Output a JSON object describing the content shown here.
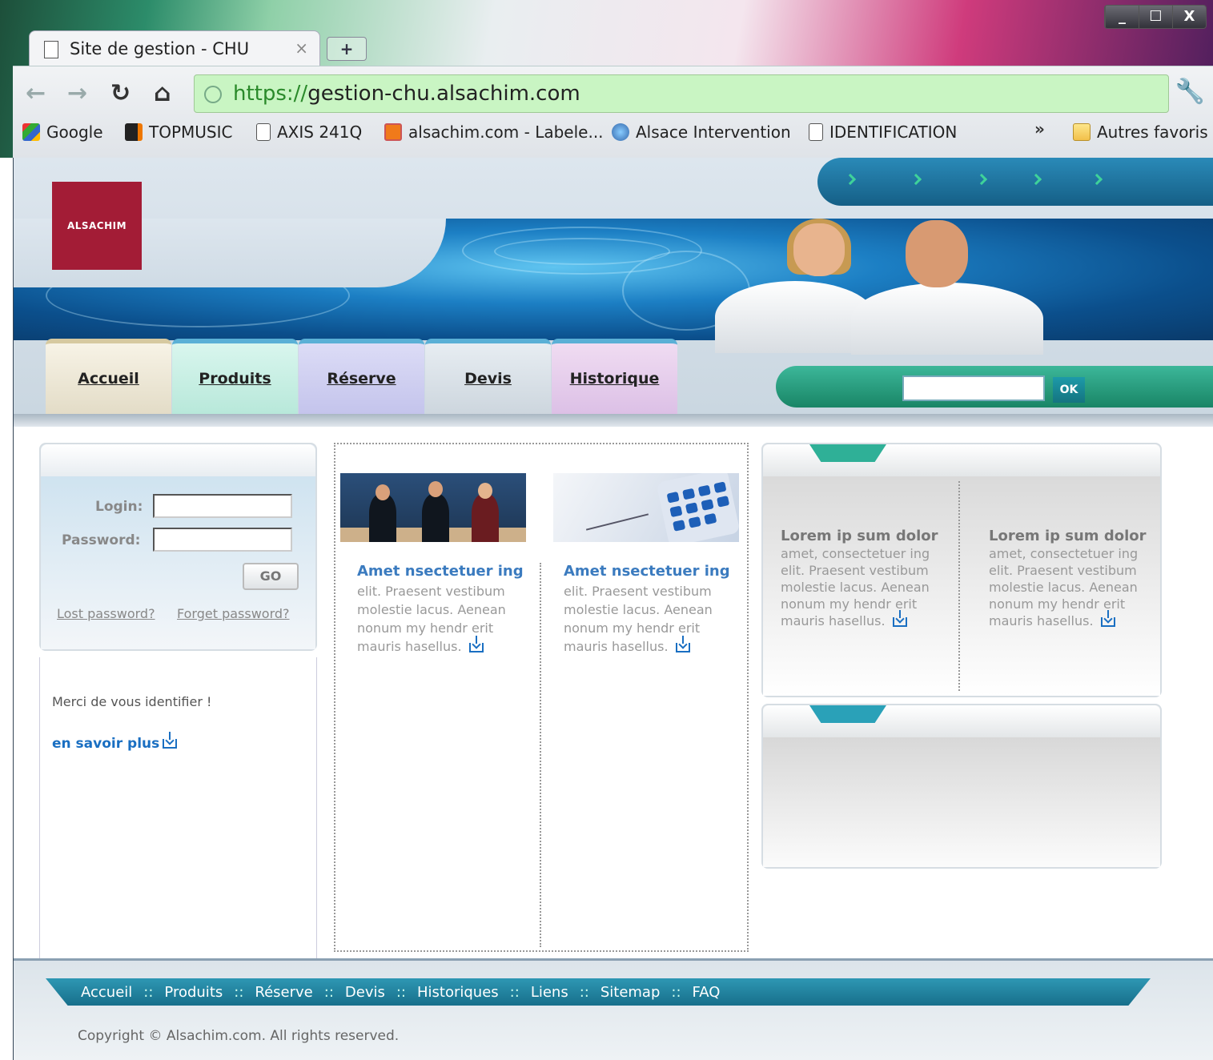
{
  "browser": {
    "tab_title": "Site de gestion - CHU",
    "tab_close": "×",
    "new_tab": "+",
    "url_scheme": "https://",
    "url_host": "gestion-chu.alsachim.com",
    "window_controls": [
      "_",
      "☐",
      "X"
    ],
    "bookmarks": [
      {
        "label": "Google",
        "icon": "google-icon"
      },
      {
        "label": "TOPMUSIC",
        "icon": "topmusic-icon"
      },
      {
        "label": "AXIS 241Q",
        "icon": "page-icon"
      },
      {
        "label": "alsachim.com - Labele...",
        "icon": "xampp-icon"
      },
      {
        "label": "Alsace Intervention",
        "icon": "globe-icon"
      },
      {
        "label": "IDENTIFICATION",
        "icon": "page-icon"
      }
    ],
    "bookmarks_more": "»",
    "other_bookmarks": "Autres favoris"
  },
  "site": {
    "logo_text": "ALSACHIM",
    "nav": [
      {
        "label": "Accueil",
        "color": "#e3dcc7"
      },
      {
        "label": "Produits",
        "color": "#b8e8da"
      },
      {
        "label": "Réserve",
        "color": "#c4c4ec"
      },
      {
        "label": "Devis",
        "color": "#cdd6de"
      },
      {
        "label": "Historique",
        "color": "#dcc0e6"
      }
    ],
    "search_button": "OK",
    "search_value": ""
  },
  "login": {
    "login_label": "Login:",
    "password_label": "Password:",
    "login_value": "",
    "password_value": "",
    "go_label": "GO",
    "lost_password": "Lost password?",
    "forget_password": "Forget password?"
  },
  "left": {
    "message": "Merci de vous identifier !",
    "more_link": "en savoir plus"
  },
  "articles": [
    {
      "title": "Amet nsectetuer ing",
      "text": "elit. Praesent vestibum molestie lacus. Aenean nonum my hendr erit mauris hasellus."
    },
    {
      "title": "Amet nsectetuer ing",
      "text": "elit. Praesent vestibum molestie lacus. Aenean nonum my hendr erit mauris hasellus."
    }
  ],
  "right": [
    {
      "title": "Lorem ip sum dolor",
      "text": "amet, consectetuer ing elit. Praesent vestibum molestie lacus. Aenean nonum my hendr erit mauris hasellus."
    },
    {
      "title": "Lorem ip sum dolor",
      "text": "amet, consectetuer ing elit. Praesent vestibum molestie lacus. Aenean nonum my hendr erit mauris hasellus."
    }
  ],
  "footer": {
    "links": [
      "Accueil",
      "Produits",
      "Réserve",
      "Devis",
      "Historiques",
      "Liens",
      "Sitemap",
      "FAQ"
    ],
    "separator": "::",
    "copyright": "Copyright © Alsachim.com. All rights reserved."
  }
}
